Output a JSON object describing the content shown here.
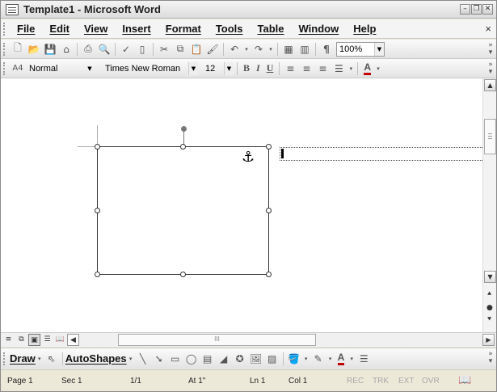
{
  "window": {
    "title": "Template1 - Microsoft Word",
    "controls": [
      "minimize-icon",
      "restore-icon",
      "close-icon"
    ]
  },
  "menubar": {
    "items": [
      "File",
      "Edit",
      "View",
      "Insert",
      "Format",
      "Tools",
      "Table",
      "Window",
      "Help"
    ],
    "close_glyph": "×"
  },
  "standard_toolbar": {
    "zoom": "100%",
    "icons": [
      "new-icon",
      "open-icon",
      "save-icon",
      "permission-icon",
      "print-icon",
      "print-preview-icon",
      "spelling-icon",
      "research-icon",
      "cut-icon",
      "copy-icon",
      "paste-icon",
      "format-painter-icon",
      "undo-icon",
      "redo-icon",
      "insert-table-icon",
      "columns-icon",
      "show-formatting-icon"
    ]
  },
  "formatting_toolbar": {
    "style": "Normal",
    "font": "Times New Roman",
    "size": "12",
    "bold": "B",
    "italic": "I",
    "underline": "U",
    "font_color": "A"
  },
  "drawing_toolbar": {
    "draw_label": "Draw",
    "autoshapes_label": "AutoShapes"
  },
  "statusbar": {
    "page": "Page 1",
    "sec": "Sec 1",
    "pages": "1/1",
    "at": "At 1\"",
    "ln": "Ln 1",
    "col": "Col 1",
    "rec": "REC",
    "trk": "TRK",
    "ext": "EXT",
    "ovr": "OVR"
  },
  "colors": {
    "chrome": "#ece9d8",
    "toolbar": "#f0f0f0",
    "frame_border": "#333333",
    "dim_text": "#a9a9a9"
  }
}
